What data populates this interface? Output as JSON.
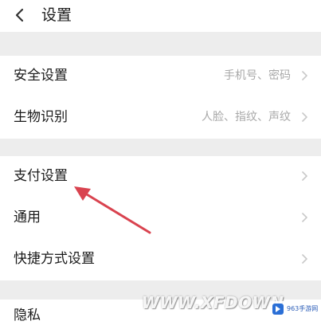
{
  "header": {
    "title": "设置"
  },
  "groups": [
    {
      "items": [
        {
          "label": "安全设置",
          "value": "手机号、密码"
        },
        {
          "label": "生物识别",
          "value": "人脸、指纹、声纹"
        }
      ]
    },
    {
      "items": [
        {
          "label": "支付设置",
          "value": ""
        },
        {
          "label": "通用",
          "value": ""
        },
        {
          "label": "快捷方式设置",
          "value": ""
        }
      ]
    },
    {
      "items": [
        {
          "label": "隐私",
          "value": ""
        }
      ]
    }
  ],
  "annotation": {
    "arrow_color": "#d9434f"
  },
  "watermark": {
    "text": "WWW.XFDOWN",
    "badge": "963手游网"
  },
  "colors": {
    "background": "#ededed",
    "card": "#ffffff",
    "secondary_text": "#a8a8a8"
  }
}
